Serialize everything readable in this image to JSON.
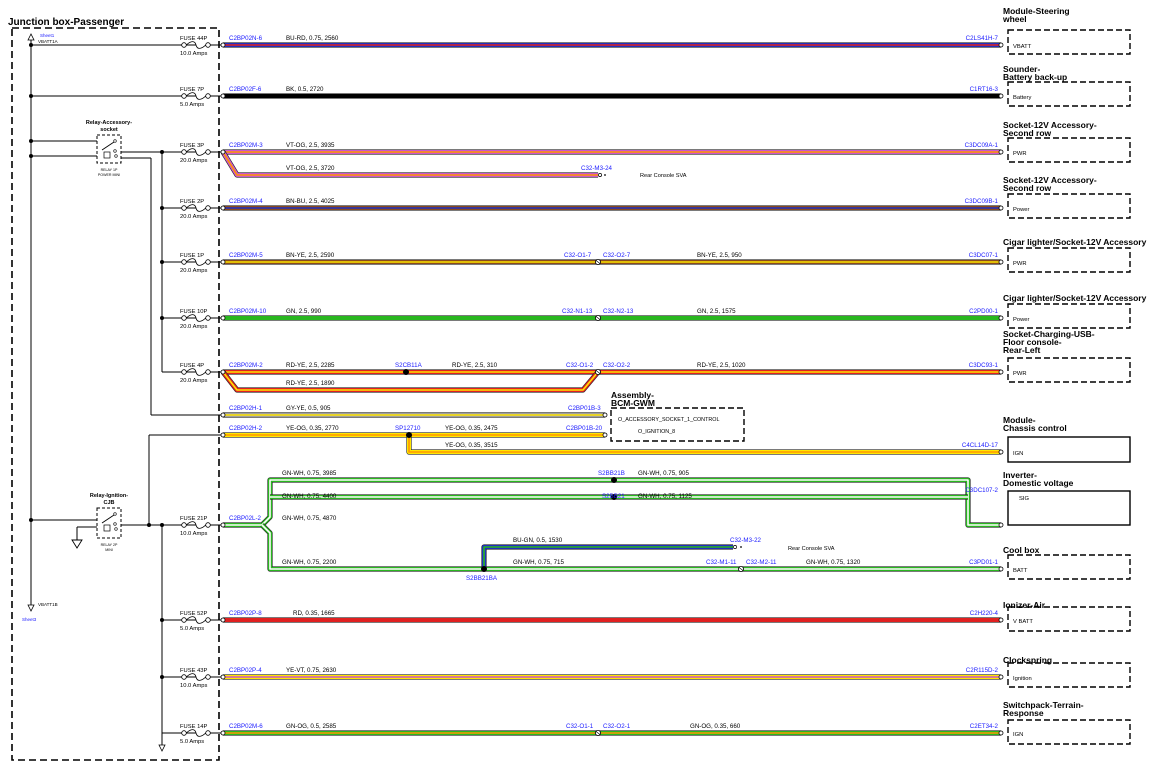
{
  "junction_box": {
    "title": "Junction box-Passenger",
    "sheet_top": "Sheet1",
    "vbatt_top": "VBATT1A",
    "vbatt_bottom": "VBATT1B",
    "sheet_bottom": "Sheet3"
  },
  "relays": {
    "accessory": {
      "title_line1": "Relay-Accessory-",
      "title_line2": "socket",
      "sub1": "RELAY 1P",
      "sub2": "POWER MINI"
    },
    "ignition": {
      "title_line1": "Relay-Ignition-",
      "title_line2": "CJB",
      "sub1": "RELAY 2P",
      "sub2": "MINI"
    }
  },
  "fuses": [
    {
      "name": "FUSE 44P",
      "rating": "10.0 Amps"
    },
    {
      "name": "FUSE 7P",
      "rating": "5.0 Amps"
    },
    {
      "name": "FUSE 3P",
      "rating": "20.0 Amps"
    },
    {
      "name": "FUSE 2P",
      "rating": "20.0 Amps"
    },
    {
      "name": "FUSE 1P",
      "rating": "20.0 Amps"
    },
    {
      "name": "FUSE 10P",
      "rating": "20.0 Amps"
    },
    {
      "name": "FUSE 4P",
      "rating": "20.0 Amps"
    },
    {
      "name": "FUSE 21P",
      "rating": "10.0 Amps"
    },
    {
      "name": "FUSE 52P",
      "rating": "5.0 Amps"
    },
    {
      "name": "FUSE 43P",
      "rating": "10.0 Amps"
    },
    {
      "name": "FUSE 14P",
      "rating": "5.0 Amps"
    }
  ],
  "pins": {
    "p44": "C2BP02N-6",
    "p7": "C2BP02F-6",
    "p3": "C2BP02M-3",
    "p2": "C2BP02M-4",
    "p1": "C2BP02M-5",
    "p10": "C2BP02M-10",
    "p4": "C2BP02M-2",
    "h1": "C2BP02H-1",
    "h2": "C2BP02H-2",
    "l2": "C2BP02L-2",
    "p52": "C2BP02P-8",
    "p43": "C2BP02P-4",
    "p14": "C2BP02M-6"
  },
  "wires": {
    "w44": "BU-RD, 0.75, 2560",
    "w7": "BK, 0.5, 2720",
    "w3a": "VT-OG, 2.5, 3935",
    "w3b": "VT-OG, 2.5, 3720",
    "w2": "BN-BU, 2.5, 4025",
    "w1a": "BN-YE, 2.5, 2590",
    "w1b": "BN-YE, 2.5, 950",
    "w10a": "GN, 2.5, 990",
    "w10b": "GN, 2.5, 1575",
    "w4a": "RD-YE, 2.5, 2285",
    "w4b": "RD-YE, 2.5, 310",
    "w4c": "RD-YE, 2.5, 1020",
    "w4d": "RD-YE, 2.5, 1890",
    "wh1": "GY-YE, 0.5, 905",
    "wh2": "YE-OG, 0.35, 2770",
    "wh2b": "YE-OG, 0.35, 2475",
    "wh2c": "YE-OG, 0.35, 3515",
    "g1": "GN-WH, 0.75, 3985",
    "g1b": "GN-WH, 0.75, 905",
    "g2": "GN-WH, 0.75, 4400",
    "g2b": "GN-WH, 0.75, 1125",
    "g3": "GN-WH, 0.75, 4870",
    "bu": "BU-GN, 0.5, 1530",
    "g4": "GN-WH, 0.75, 2200",
    "g4b": "GN-WH, 0.75, 715",
    "g4c": "GN-WH, 0.75, 1320",
    "w52": "RD, 0.35, 1665",
    "w43": "YE-VT, 0.75, 2630",
    "w14a": "GN-OG, 0.5, 2585",
    "w14b": "GN-OG, 0.35, 660"
  },
  "connectors": {
    "m324": "C32-M3-24",
    "rear_sva1": "Rear Console SVA",
    "c32o17": "C32-O1-7",
    "c32o27": "C32-O2-7",
    "c32n113": "C32-N1-13",
    "c32n213": "C32-N2-13",
    "s2cb11a": "S2CB11A",
    "c32o12": "C32-O1-2",
    "c32o22": "C32-O2-2",
    "c2bp01b3": "C2BP01B-3",
    "c2bp01b20": "C2BP01B-20",
    "sp12710": "SP12710",
    "s2bb21b": "S2BB21B",
    "s2bb21": "S2BB21",
    "c32m322": "C32-M3-22",
    "rear_sva2": "Rear Console SVA",
    "s2bb21ba": "S2BB21BA",
    "c32m111": "C32-M1-11",
    "c32m211": "C32-M2-11",
    "c32o11": "C32-O1-1",
    "c32o21": "C32-O2-1"
  },
  "bcm": {
    "title1": "Assembly-",
    "title2": "BCM-GWM",
    "line1": "O_ACCESSORY_SOCKET_1_CONTROL",
    "line2": "O_IGNITION_8"
  },
  "modules": [
    {
      "title1": "Module-Steering",
      "title2": "wheel",
      "title3": "",
      "pin": "C2LS41H-7",
      "label": "VBATT"
    },
    {
      "title1": "Sounder-",
      "title2": "Battery back-up",
      "title3": "",
      "pin": "C1RT16-3",
      "label": "Battery"
    },
    {
      "title1": "Socket-12V Accessory-",
      "title2": "Second row",
      "title3": "",
      "pin": "C3DC09A-1",
      "label": "PWR"
    },
    {
      "title1": "Socket-12V Accessory-",
      "title2": "Second row",
      "title3": "",
      "pin": "C3DC09B-1",
      "label": "Power"
    },
    {
      "title1": "Cigar lighter/Socket-12V Accessory",
      "title2": "",
      "title3": "",
      "pin": "C3DC07-1",
      "label": "PWR"
    },
    {
      "title1": "Cigar lighter/Socket-12V Accessory",
      "title2": "",
      "title3": "",
      "pin": "C2PD00-1",
      "label": "Power"
    },
    {
      "title1": "Socket-Charging-USB-",
      "title2": "Floor console-",
      "title3": "Rear-Left",
      "pin": "C3DC93-1",
      "label": "PWR"
    },
    {
      "title1": "Module-",
      "title2": "Chassis control",
      "title3": "",
      "pin": "C4CL14D-17",
      "label": "IGN"
    },
    {
      "title1": "Inverter-",
      "title2": "Domestic voltage",
      "title3": "",
      "pin": "C3DC107-2",
      "label": "SIG"
    },
    {
      "title1": "Cool box",
      "title2": "",
      "title3": "",
      "pin": "C3PD01-1",
      "label": "BATT"
    },
    {
      "title1": "Ionizer-Air",
      "title2": "",
      "title3": "",
      "pin": "C2H220-4",
      "label": "V BATT"
    },
    {
      "title1": "Clockspring",
      "title2": "",
      "title3": "",
      "pin": "C2R115D-2",
      "label": "Ignition"
    },
    {
      "title1": "Switchpack-Terrain-",
      "title2": "Response",
      "title3": "",
      "pin": "C2ET34-2",
      "label": "IGN"
    }
  ],
  "colors": {
    "BU": "#1f2fbf",
    "RD": "#e02020",
    "BK": "#000000",
    "VT": "#cc55cc",
    "OG": "#ff9900",
    "BN": "#8a4a1c",
    "YE": "#ffe600",
    "GN": "#29b71f",
    "WH": "#ffffff",
    "GY": "#a0a0a0",
    "label_blue": "#1a1aff"
  }
}
